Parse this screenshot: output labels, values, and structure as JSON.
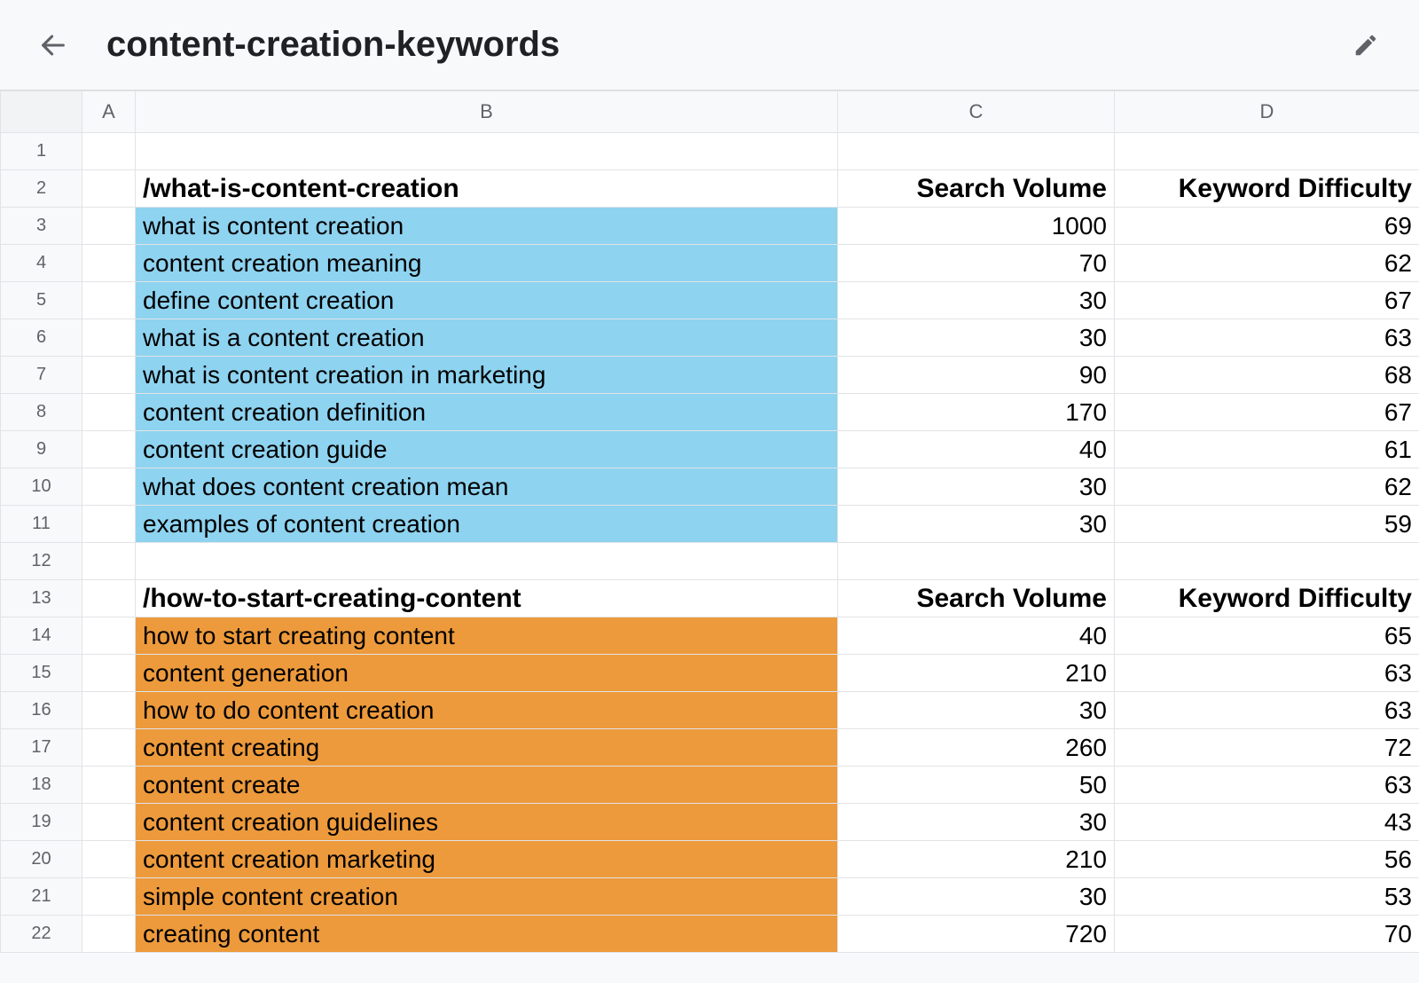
{
  "header": {
    "title": "content-creation-keywords"
  },
  "columns": {
    "A": "A",
    "B": "B",
    "C": "C",
    "D": "D"
  },
  "sections": [
    {
      "slug": "/what-is-content-creation",
      "header_c": "Search Volume",
      "header_d": "Keyword Difficulty",
      "color": "blue",
      "rows": [
        {
          "kw": "what is content creation",
          "vol": "1000",
          "diff": "69"
        },
        {
          "kw": "content creation meaning",
          "vol": "70",
          "diff": "62"
        },
        {
          "kw": "define content creation",
          "vol": "30",
          "diff": "67"
        },
        {
          "kw": "what is a content creation",
          "vol": "30",
          "diff": "63"
        },
        {
          "kw": "what is content creation in marketing",
          "vol": "90",
          "diff": "68"
        },
        {
          "kw": "content creation definition",
          "vol": "170",
          "diff": "67"
        },
        {
          "kw": "content creation guide",
          "vol": "40",
          "diff": "61"
        },
        {
          "kw": "what does content creation mean",
          "vol": "30",
          "diff": "62"
        },
        {
          "kw": "examples of content creation",
          "vol": "30",
          "diff": "59"
        }
      ]
    },
    {
      "slug": "/how-to-start-creating-content",
      "header_c": "Search Volume",
      "header_d": "Keyword Difficulty",
      "color": "orange",
      "rows": [
        {
          "kw": "how to start creating content",
          "vol": "40",
          "diff": "65"
        },
        {
          "kw": "content generation",
          "vol": "210",
          "diff": "63"
        },
        {
          "kw": "how to do content creation",
          "vol": "30",
          "diff": "63"
        },
        {
          "kw": "content creating",
          "vol": "260",
          "diff": "72"
        },
        {
          "kw": "content create",
          "vol": "50",
          "diff": "63"
        },
        {
          "kw": "content creation guidelines",
          "vol": "30",
          "diff": "43"
        },
        {
          "kw": "content creation marketing",
          "vol": "210",
          "diff": "56"
        },
        {
          "kw": "simple content creation",
          "vol": "30",
          "diff": "53"
        },
        {
          "kw": "creating content",
          "vol": "720",
          "diff": "70"
        }
      ]
    }
  ]
}
